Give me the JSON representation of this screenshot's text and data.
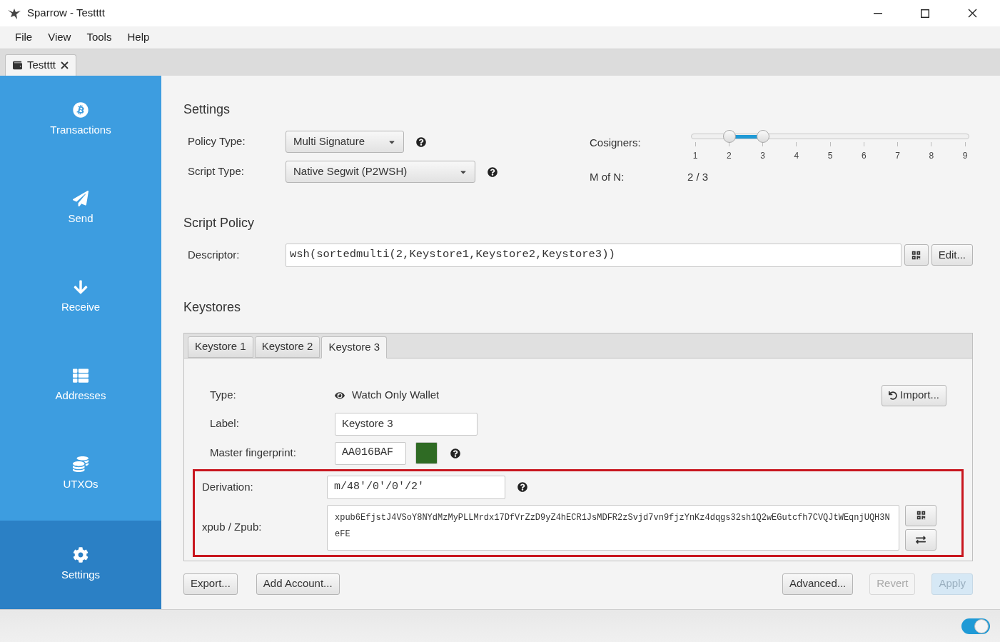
{
  "window": {
    "title": "Sparrow - Testttt"
  },
  "menu": [
    "File",
    "View",
    "Tools",
    "Help"
  ],
  "doc_tabs": [
    {
      "label": "Testttt",
      "selected": true
    }
  ],
  "sidebar": [
    {
      "kind": "bitcoin",
      "label": "Transactions",
      "selected": false
    },
    {
      "kind": "send",
      "label": "Send",
      "selected": false
    },
    {
      "kind": "receive",
      "label": "Receive",
      "selected": false
    },
    {
      "kind": "addresses",
      "label": "Addresses",
      "selected": false
    },
    {
      "kind": "utxos",
      "label": "UTXOs",
      "selected": false
    },
    {
      "kind": "settings",
      "label": "Settings",
      "selected": true
    }
  ],
  "settings": {
    "title": "Settings",
    "policy_type": {
      "label": "Policy Type:",
      "value": "Multi Signature"
    },
    "script_type": {
      "label": "Script Type:",
      "value": "Native Segwit (P2WSH)"
    },
    "cosigners": {
      "label": "Cosigners:",
      "ticks": [
        "1",
        "2",
        "3",
        "4",
        "5",
        "6",
        "7",
        "8",
        "9"
      ],
      "thumbs": [
        {
          "level": 0.125
        },
        {
          "level": 0.25
        }
      ]
    },
    "m_of_n": {
      "label": "M of N:",
      "value": "2 / 3"
    }
  },
  "script_policy": {
    "title": "Script Policy",
    "label": "Descriptor:",
    "value": "wsh(sortedmulti(2,Keystore1,Keystore2,Keystore3))",
    "edit_button": "Edit..."
  },
  "keystores": {
    "title": "Keystores",
    "tabs": [
      {
        "label": "Keystore 1",
        "selected": false
      },
      {
        "label": "Keystore 2",
        "selected": false
      },
      {
        "label": "Keystore 3",
        "selected": true
      }
    ],
    "type_label": "Type:",
    "type_value": "Watch Only Wallet",
    "import_button": "Import...",
    "label_label": "Label:",
    "label_value": "Keystore 3",
    "fingerprint_label": "Master fingerprint:",
    "fingerprint_value": "AA016BAF",
    "derivation_label": "Derivation:",
    "derivation_value": "m/48'/0'/0'/2'",
    "xpub_label": "xpub / Zpub:",
    "xpub_value": "xpub6EfjstJ4VSoY8NYdMzMyPLLMrdx17DfVrZzD9yZ4hECR1JsMDFR2zSvjd7vn9fjzYnKz4dqgs32sh1Q2wEGutcfh7CVQJtWEqnjUQH3NeFE",
    "highlighted": true
  },
  "footer_buttons": [
    {
      "label": "Export...",
      "disabled": false,
      "primary": false
    },
    {
      "label": "Add Account...",
      "disabled": false,
      "primary": false
    },
    {
      "label": "Advanced...",
      "disabled": false,
      "primary": false
    },
    {
      "label": "Revert",
      "disabled": true,
      "primary": false
    },
    {
      "label": "Apply",
      "disabled": true,
      "primary": true
    }
  ],
  "status_bar": {
    "toggle_on": true
  }
}
